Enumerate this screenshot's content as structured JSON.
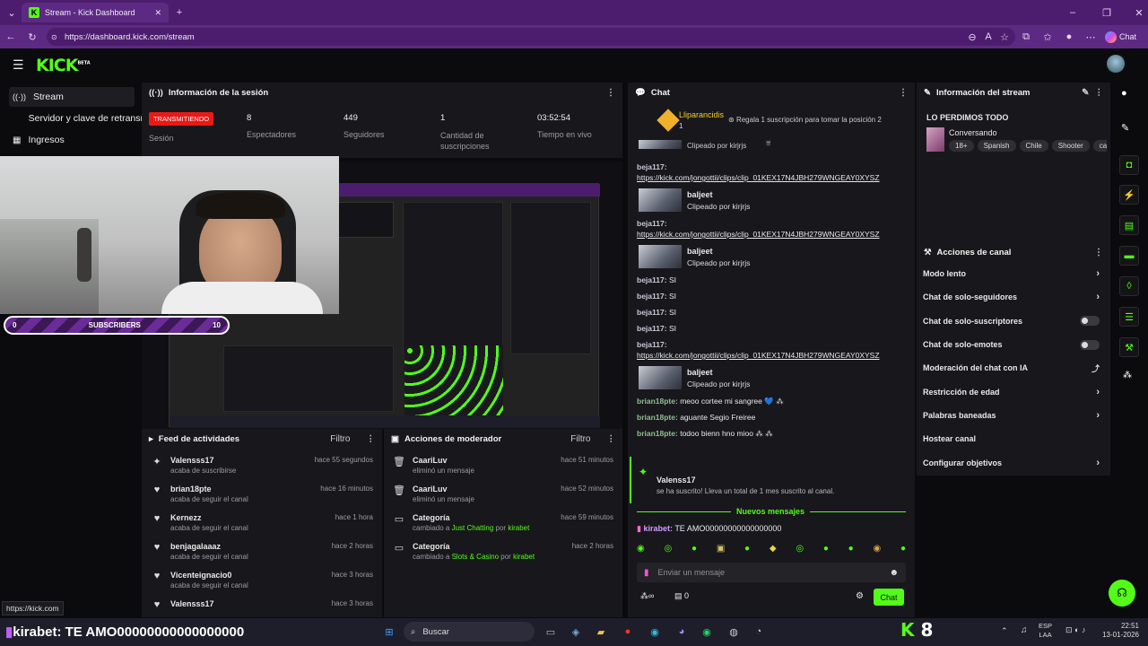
{
  "browser": {
    "tab_title": "Stream - Kick Dashboard",
    "url": "https://dashboard.kick.com/stream",
    "chat_btn": "Chat",
    "status_url": "https://kick.com"
  },
  "nav": {
    "items": [
      {
        "label": "Stream",
        "icon": "broadcast-icon"
      },
      {
        "label": "Servidor y clave de retransm",
        "icon": "key-icon"
      },
      {
        "label": "Ingresos",
        "icon": "chart-icon"
      }
    ]
  },
  "session": {
    "title": "Información de la sesión",
    "badge": "TRANSMITIENDO",
    "badge_label": "Sesión",
    "stats": [
      {
        "value": "8",
        "label": "Espectadores"
      },
      {
        "value": "449",
        "label": "Seguidores"
      },
      {
        "value": "1",
        "label": "Cantidad de suscripciones"
      },
      {
        "value": "03:52:54",
        "label": "Tiempo en vivo"
      }
    ]
  },
  "overlay": {
    "subscribers_label": "SUBSCRIBERS",
    "left_num": "0",
    "right_num": "10",
    "ticker": "kirabet: TE AMO000000000000000000"
  },
  "feed": {
    "title": "Feed de actividades",
    "filter": "Filtro",
    "items": [
      {
        "name": "Valensss17",
        "action": "acaba de suscribirse",
        "time": "hace 55 segundos",
        "icon": "sparkle-icon"
      },
      {
        "name": "brian18pte",
        "action": "acaba de seguir el canal",
        "time": "hace 16 minutos",
        "icon": "heart-icon"
      },
      {
        "name": "Kernezz",
        "action": "acaba de seguir el canal",
        "time": "hace 1 hora",
        "icon": "heart-icon"
      },
      {
        "name": "benjagalaaaz",
        "action": "acaba de seguir el canal",
        "time": "hace 2 horas",
        "icon": "heart-icon"
      },
      {
        "name": "Vicenteignacio0",
        "action": "acaba de seguir el canal",
        "time": "hace 3 horas",
        "icon": "heart-icon"
      },
      {
        "name": "Valensss17",
        "action": "",
        "time": "hace 3 horas",
        "icon": "heart-icon"
      }
    ]
  },
  "mod": {
    "title": "Acciones de moderador",
    "filter": "Filtro",
    "items": [
      {
        "name": "CaariLuv",
        "action": "eliminó un mensaje",
        "time": "hace 51 minutos",
        "pre": "",
        "hl": "",
        "mid": "",
        "by": ""
      },
      {
        "name": "CaariLuv",
        "action": "eliminó un mensaje",
        "time": "hace 52 minutos",
        "pre": "",
        "hl": "",
        "mid": "",
        "by": ""
      },
      {
        "name": "Categoría",
        "action": "",
        "time": "hace 59 minutos",
        "pre": "cambiado a ",
        "hl": "Just Chatting",
        "mid": " por ",
        "by": "kirabet"
      },
      {
        "name": "Categoría",
        "action": "",
        "time": "hace 2 horas",
        "pre": "cambiado a ",
        "hl": "Slots & Casino",
        "mid": " por ",
        "by": "kirabet"
      }
    ]
  },
  "chat": {
    "title": "Chat",
    "pinned_user": "Lliparancidis",
    "pinned_count": "1",
    "gift_text": "Regala 1 suscripción para tomar la posición 2",
    "clipped_partial": "Clipeado por kirjrjs",
    "messages": [
      {
        "type": "link",
        "user": "beja117:",
        "text": "https://kick.com/jongottii/clips/clip_01KEX17N4JBH279WNGEAY0XYSZ"
      },
      {
        "type": "clip",
        "title": "baljeet",
        "sub": "Clipeado por kirjrjs"
      },
      {
        "type": "link",
        "user": "beja117:",
        "text": "https://kick.com/jongottii/clips/clip_01KEX17N4JBH279WNGEAY0XYSZ"
      },
      {
        "type": "clip",
        "title": "baljeet",
        "sub": "Clipeado por kirjrjs"
      },
      {
        "type": "text",
        "user": "beja117:",
        "text": "SI"
      },
      {
        "type": "text",
        "user": "beja117:",
        "text": "SI"
      },
      {
        "type": "text",
        "user": "beja117:",
        "text": "SI"
      },
      {
        "type": "text",
        "user": "beja117:",
        "text": "SI"
      },
      {
        "type": "link",
        "user": "beja117:",
        "text": "https://kick.com/jongottii/clips/clip_01KEX17N4JBH279WNGEAY0XYSZ"
      },
      {
        "type": "clip",
        "title": "baljeet",
        "sub": "Clipeado por kirjrjs"
      },
      {
        "type": "text",
        "user": "brian18pte:",
        "text": "meoo cortee mi sangree 💙 ⁂"
      },
      {
        "type": "text",
        "user": "brian18pte:",
        "text": "aguante Segio Freiree"
      },
      {
        "type": "text",
        "user": "brian18pte:",
        "text": "todoo bienn hno mioo ⁂ ⁂"
      }
    ],
    "sub_event": {
      "name": "Valenss17",
      "text": "se ha suscrito! Lleva un total de 1 mes suscrito al canal."
    },
    "new_messages": "Nuevos mensajes",
    "reply": {
      "user": "kirabet:",
      "text": "TE AMO00000000000000000"
    },
    "input_placeholder": "Enviar un mensaje",
    "viewers": "0",
    "send": "Chat"
  },
  "stream_info": {
    "title": "Información del stream",
    "stream_title": "LO PERDIMOS TODO",
    "category": "Conversando",
    "tags": [
      "18+",
      "Spanish",
      "Chile",
      "Shooter",
      "casin"
    ]
  },
  "channel_actions": {
    "title": "Acciones de canal",
    "items": [
      {
        "label": "Modo lento",
        "ctrl": "chevron"
      },
      {
        "label": "Chat de solo-seguidores",
        "ctrl": "chevron"
      },
      {
        "label": "Chat de solo-suscriptores",
        "ctrl": "toggle"
      },
      {
        "label": "Chat de solo-emotes",
        "ctrl": "toggle"
      },
      {
        "label": "Moderación del chat con IA",
        "ctrl": "chart"
      },
      {
        "label": "Restricción de edad",
        "ctrl": "chevron"
      },
      {
        "label": "Palabras baneadas",
        "ctrl": "chevron"
      },
      {
        "label": "Hostear canal",
        "ctrl": "none"
      },
      {
        "label": "Configurar objetivos",
        "ctrl": "chevron"
      }
    ]
  },
  "taskbar": {
    "overlay_text": "kirabet: TE AMO00000000000000000",
    "search": "Buscar",
    "kick_count": "8",
    "lang": "ESP",
    "lang2": "LAA",
    "time": "22:51",
    "date": "13-01-2026"
  }
}
